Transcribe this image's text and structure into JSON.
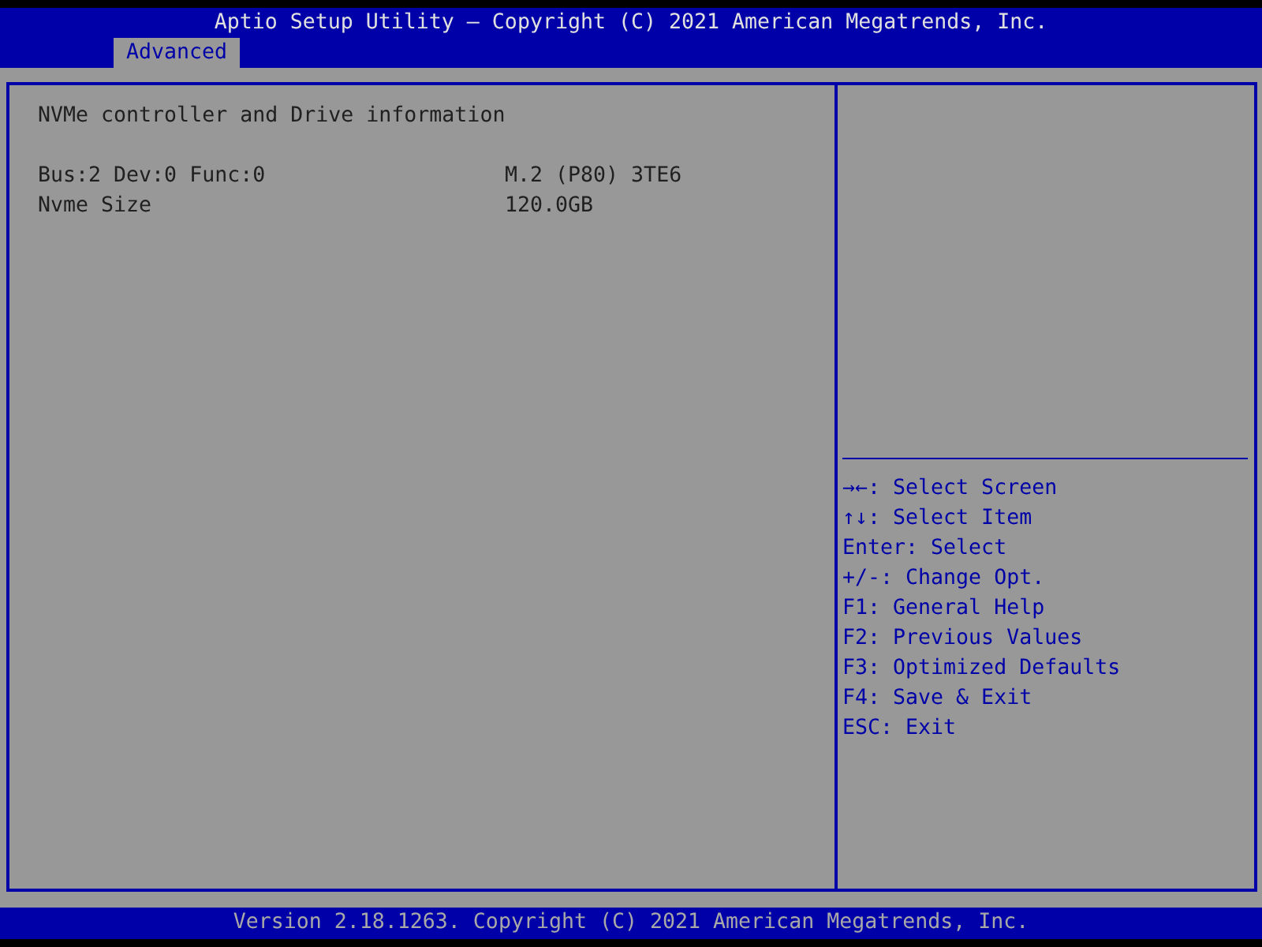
{
  "header": {
    "title": "Aptio Setup Utility – Copyright (C) 2021 American Megatrends, Inc."
  },
  "tabs": [
    {
      "label": "Advanced",
      "selected": true
    }
  ],
  "main": {
    "heading": "NVMe controller and Drive information",
    "rows": [
      {
        "label": "Bus:2 Dev:0 Func:0",
        "value": "M.2 (P80) 3TE6"
      },
      {
        "label": "Nvme Size",
        "value": "120.0GB"
      }
    ]
  },
  "help": [
    "→←: Select Screen",
    "↑↓: Select Item",
    "Enter: Select",
    "+/-: Change Opt.",
    "F1: General Help",
    "F2: Previous Values",
    "F3: Optimized Defaults",
    "F4: Save & Exit",
    "ESC: Exit"
  ],
  "footer": {
    "text": "Version 2.18.1263. Copyright (C) 2021 American Megatrends, Inc."
  }
}
